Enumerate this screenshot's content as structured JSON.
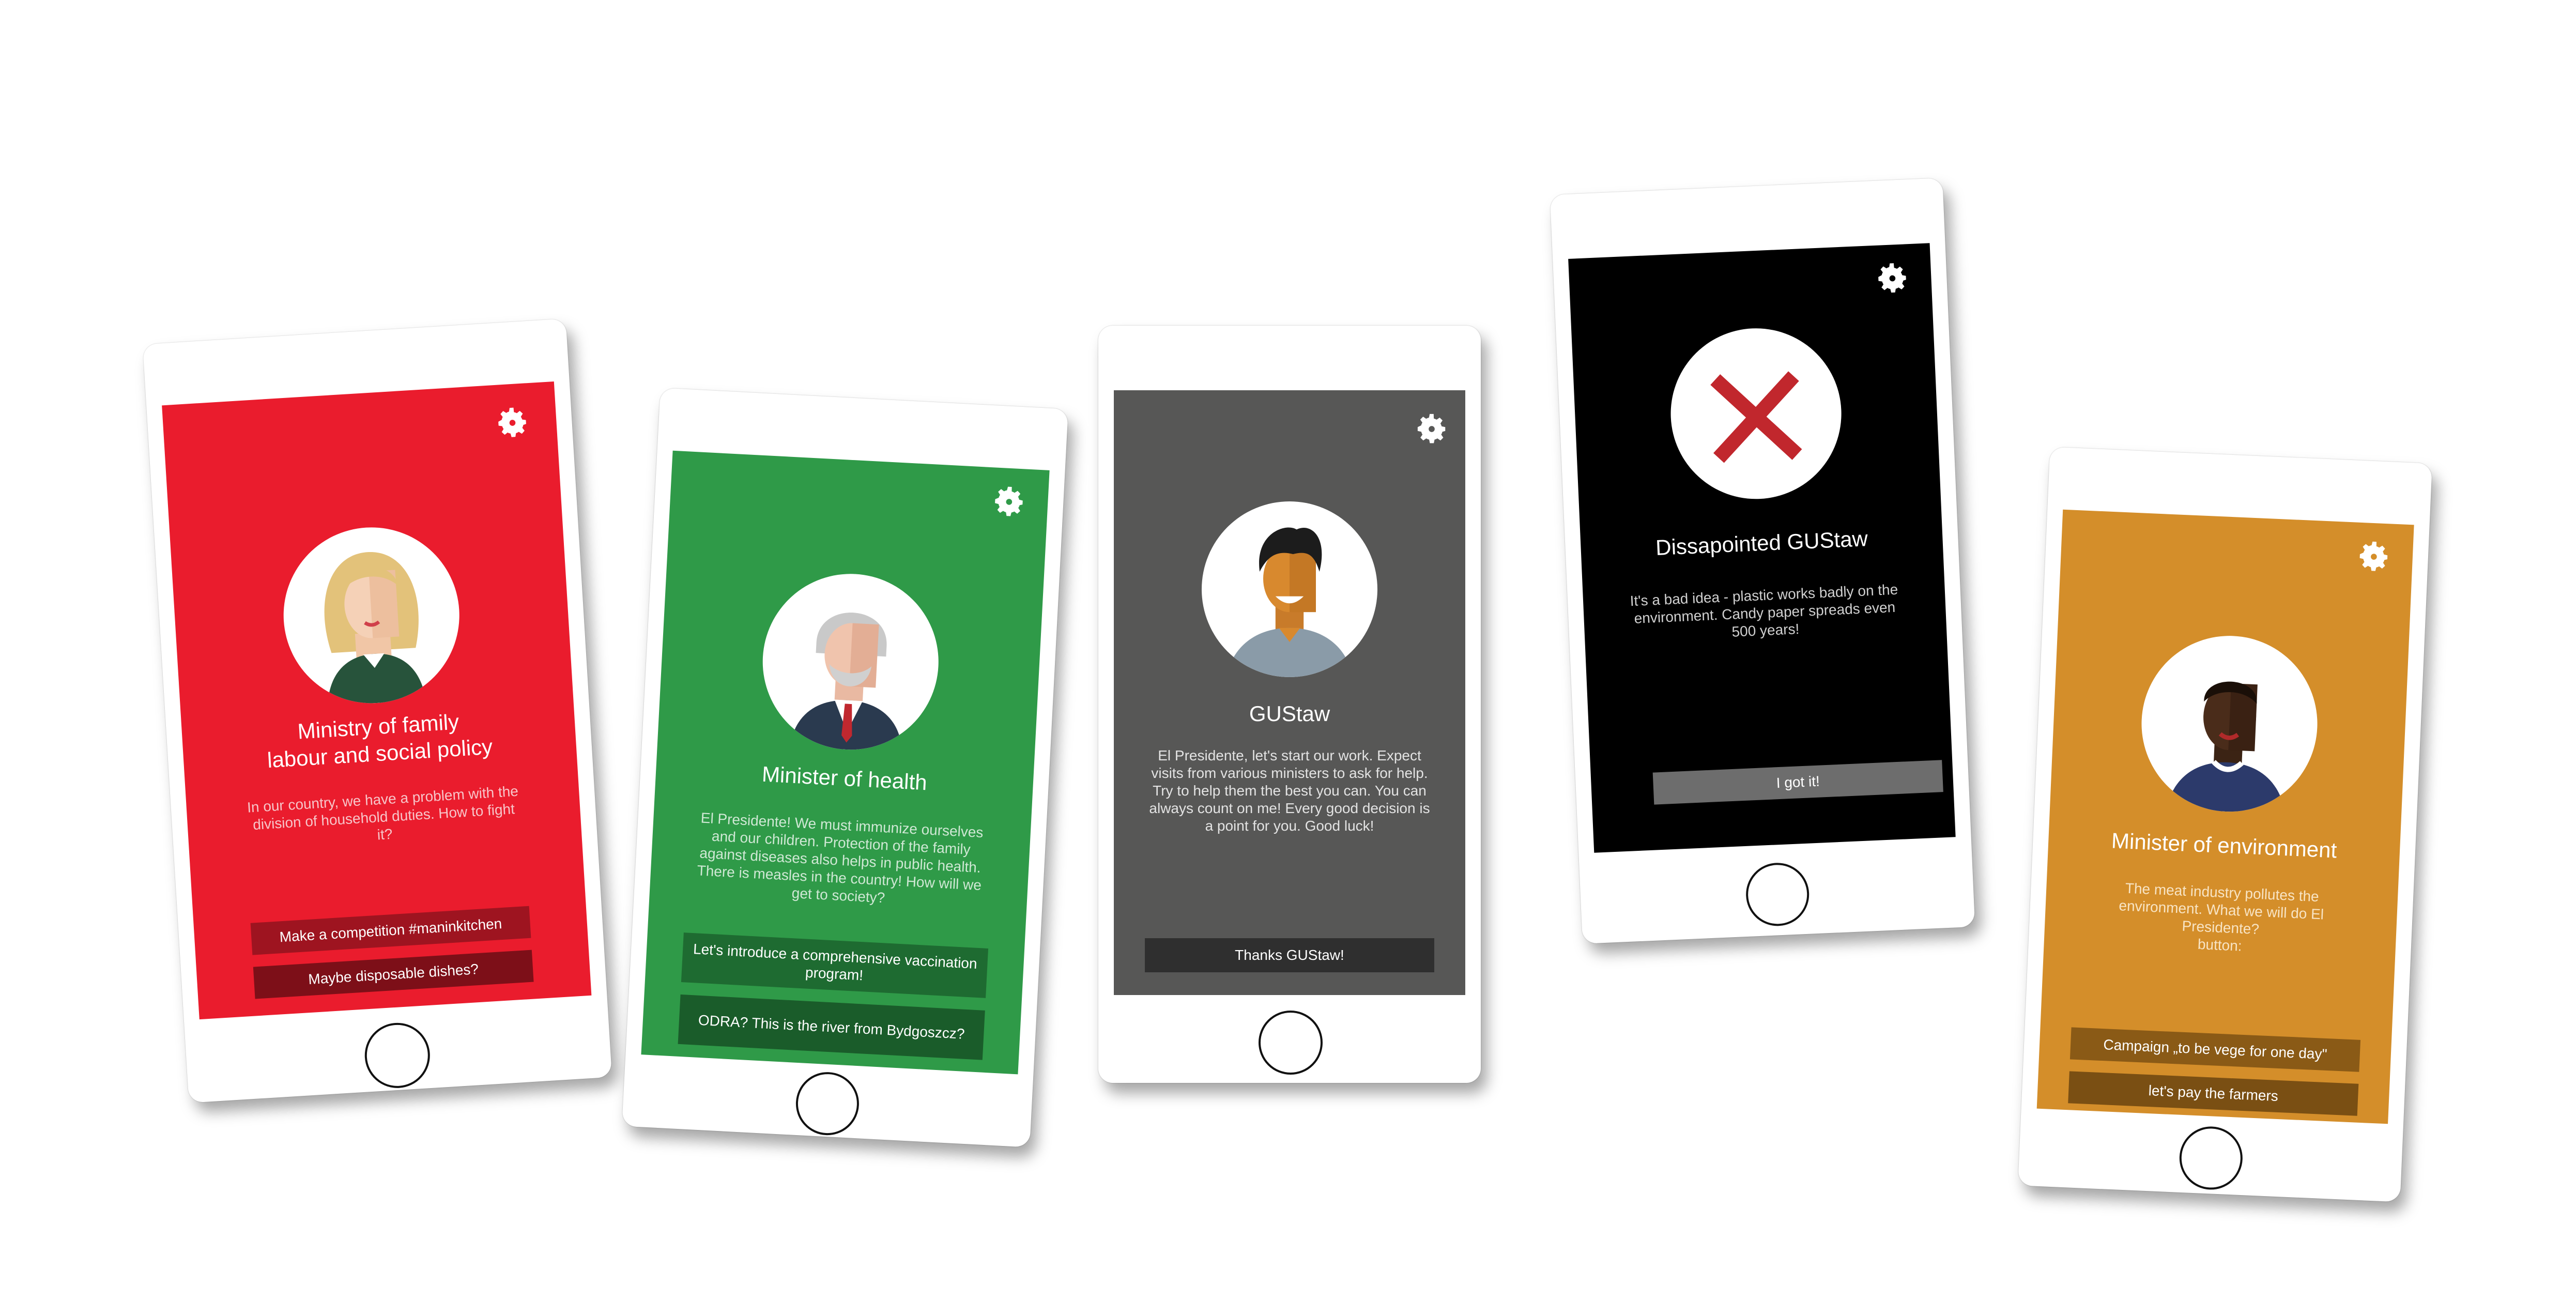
{
  "colors": {
    "red_screen": "#ea1c2d",
    "green_screen": "#2f9a48",
    "gray_screen": "#575756",
    "black_screen": "#000000",
    "orange_screen": "#d48e2a"
  },
  "phones": [
    {
      "title": "Ministry of  family\nlabour and social policy",
      "text": "In our country, we have a problem with the division of household duties. How to fight it?",
      "buttons": [
        "Make a competition #maninkitchen",
        "Maybe disposable dishes?"
      ],
      "avatar": "blonde-woman-avatar"
    },
    {
      "title": "Minister of health",
      "text": "El Presidente! We must immunize ourselves and our children. Protection of the family against diseases also helps in public health. There is measles in the country! How will we get to society?",
      "buttons": [
        "Let's introduce a comprehensive vaccination program!",
        "ODRA? This is the river from Bydgoszcz?"
      ],
      "avatar": "gray-haired-man-avatar"
    },
    {
      "title": "GUStaw",
      "text": "El Presidente, let's start our work. Expect visits from various ministers to ask for help. Try to help them the best you can. You can always count on me! Every good decision is a point for you. Good luck!",
      "buttons": [
        "Thanks GUStaw!"
      ],
      "avatar": "young-man-avatar"
    },
    {
      "title": "Dissapointed GUStaw",
      "text": "It's a bad idea - plastic works badly on the environment. Candy paper spreads even 500 years!",
      "buttons": [
        "I got it!"
      ],
      "avatar": "red-x-icon"
    },
    {
      "title": "Minister of environment",
      "text": "The meat industry pollutes the environment. What we will do El Presidente?\nbutton:",
      "buttons": [
        "Campaign „to be vege for one day\"",
        "let's pay the farmers"
      ],
      "avatar": "dark-skinned-man-avatar"
    }
  ]
}
